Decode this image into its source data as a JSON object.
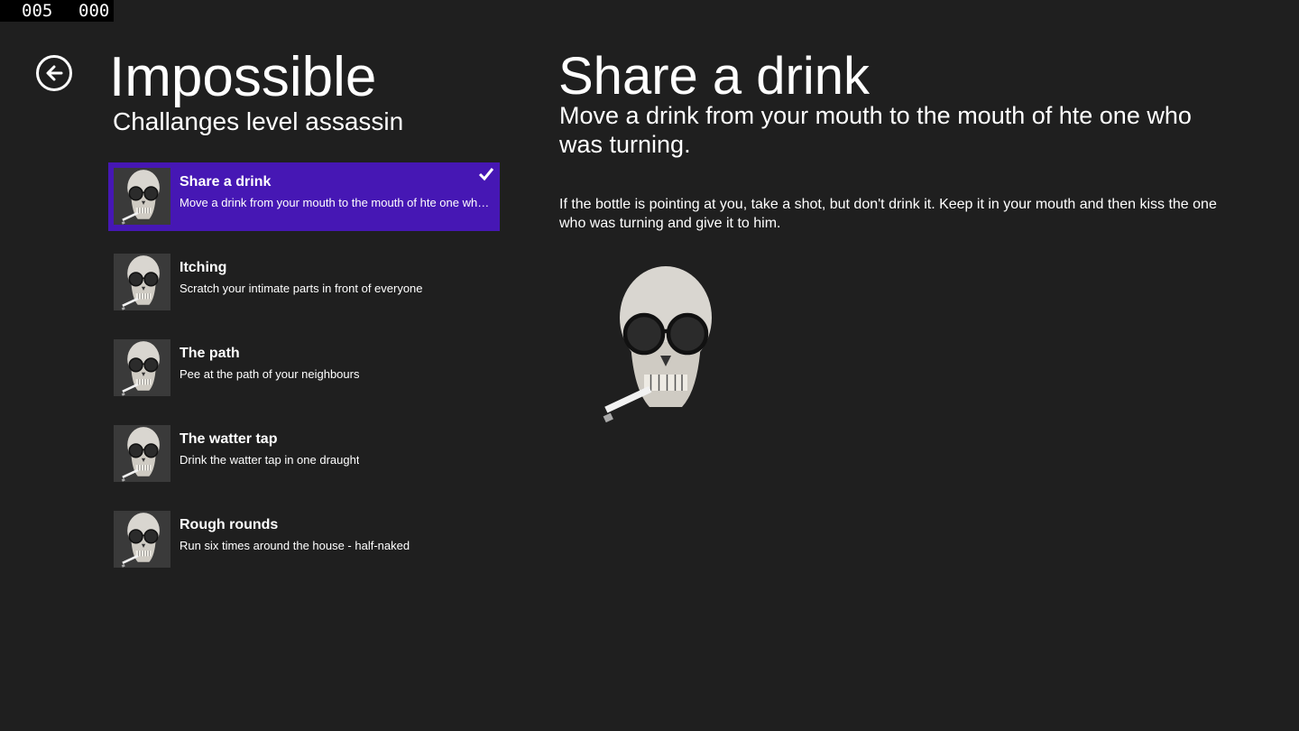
{
  "counter": {
    "left": "005",
    "right": "000"
  },
  "header": {
    "back_icon": "back-arrow-circle-icon",
    "title": "Impossible",
    "subtitle": "Challanges level assassin"
  },
  "challenges": [
    {
      "title": "Share a drink",
      "description": "Move a drink from your mouth to the mouth of hte one who was turning.",
      "selected": true
    },
    {
      "title": "Itching",
      "description": "Scratch your intimate parts in front of everyone",
      "selected": false
    },
    {
      "title": "The path",
      "description": "Pee at the path of your neighbours",
      "selected": false
    },
    {
      "title": "The watter tap",
      "description": "Drink the watter tap in one draught",
      "selected": false
    },
    {
      "title": "Rough rounds",
      "description": "Run six times around the house - half-naked",
      "selected": false
    }
  ],
  "detail": {
    "title": "Share a drink",
    "summary": "Move a drink from your mouth to the mouth of hte one who was turning.",
    "body": "If the bottle is pointing at you, take a shot, but don't drink it. Keep it in your mouth and then kiss the one who was turning and give it to him.",
    "image_icon": "skull-with-sunglasses-icon"
  },
  "colors": {
    "background": "#1f1f1f",
    "selected": "#4617b4"
  }
}
